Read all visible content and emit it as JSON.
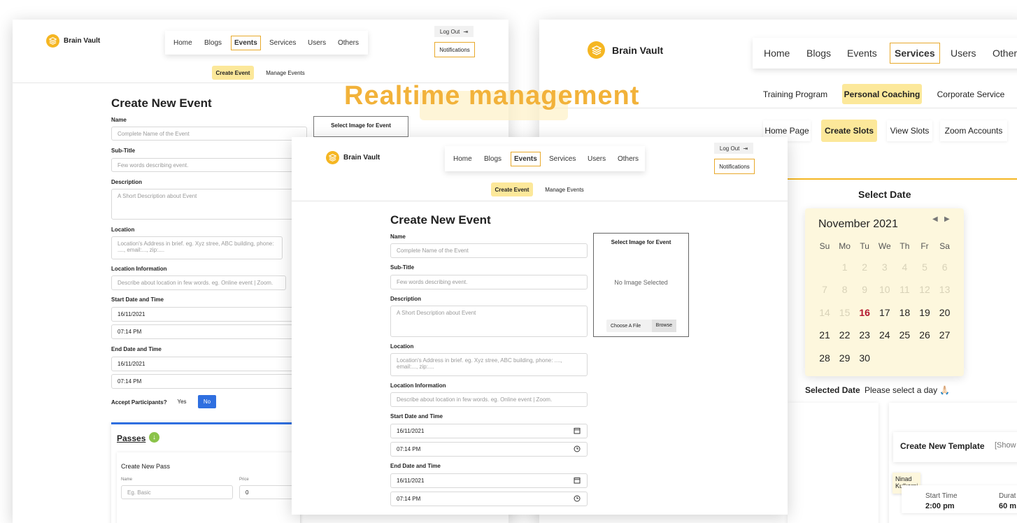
{
  "brand": {
    "name": "Brain Vault"
  },
  "headline": "Realtime management",
  "nav": {
    "home": "Home",
    "blogs": "Blogs",
    "events": "Events",
    "services": "Services",
    "users": "Users",
    "others": "Others",
    "others_truncated": "Other",
    "logout": "Log Out",
    "notifications": "Notifications"
  },
  "event_tabs": {
    "create": "Create Event",
    "manage": "Manage Events"
  },
  "service_tabs": {
    "training": "Training Program",
    "coaching": "Personal Coaching",
    "corporate": "Corporate Service"
  },
  "coaching_tabs": {
    "home": "Home Page",
    "create_slots": "Create Slots",
    "view_slots": "View Slots",
    "zoom": "Zoom Accounts"
  },
  "form": {
    "title": "Create New Event",
    "name_label": "Name",
    "name_placeholder": "Complete Name of the Event",
    "subtitle_label": "Sub-Title",
    "subtitle_placeholder": "Few words describing event.",
    "description_label": "Description",
    "description_placeholder": "A Short Description about Event",
    "location_label": "Location",
    "location_placeholder": "Location's Address in brief. eg. Xyz stree, ABC building, phone: ...., email:..., zip:....",
    "locinfo_label": "Location Information",
    "locinfo_placeholder": "Describe about location in few words. eg. Online event | Zoom.",
    "start_label": "Start Date and Time",
    "start_date": "16/11/2021",
    "start_time": "07:14 PM",
    "end_label": "End Date and Time",
    "end_date": "16/11/2021",
    "end_time": "07:14 PM",
    "accept_label": "Accept Participants?",
    "yes": "Yes",
    "no": "No",
    "image_panel_title": "Select Image for Event",
    "no_image": "No Image Selected",
    "choose_file": "Choose A File",
    "browse": "Browse"
  },
  "passes": {
    "title": "Passes",
    "create_title": "Create New Pass",
    "name_label": "Name",
    "name_placeholder": "Eg. Basic",
    "price_label": "Price",
    "price_value": "0"
  },
  "calendar": {
    "select_date": "Select Date",
    "month": "November 2021",
    "weekdays": [
      "Su",
      "Mo",
      "Tu",
      "We",
      "Th",
      "Fr",
      "Sa"
    ],
    "weeks": [
      [
        "",
        "1",
        "2",
        "3",
        "4",
        "5",
        "6"
      ],
      [
        "7",
        "8",
        "9",
        "10",
        "11",
        "12",
        "13"
      ],
      [
        "14",
        "15",
        "16",
        "17",
        "18",
        "19",
        "20"
      ],
      [
        "21",
        "22",
        "23",
        "24",
        "25",
        "26",
        "27"
      ],
      [
        "28",
        "29",
        "30",
        "",
        "",
        "",
        ""
      ]
    ],
    "today": "16",
    "selected_label": "Selected Date",
    "selected_value": "Please select a day 🙏🏻"
  },
  "template": {
    "title": "Create New Template",
    "show": "[Show",
    "user_name": "Ninad Kulkarni",
    "start_time_label": "Start Time",
    "start_time_value": "2:00 pm",
    "duration_label": "Durat",
    "duration_value": "60 m",
    "partial": "ne"
  },
  "colors": {
    "accent": "#f5b622",
    "active_tab": "#fce89a",
    "primary": "#2f6fe0",
    "today": "#b3172e",
    "calendar_bg": "#fdf7dd"
  }
}
